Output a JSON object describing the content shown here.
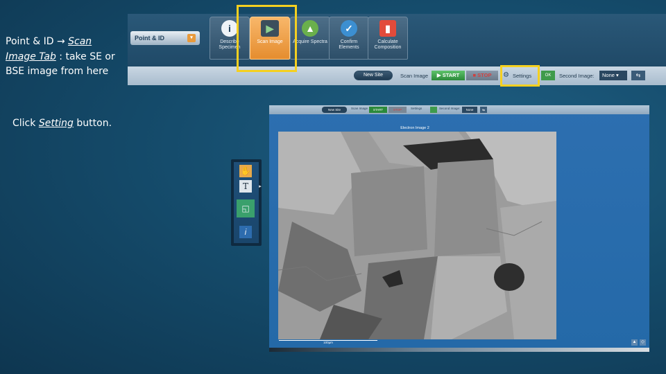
{
  "slide": {
    "line1_prefix": "Point & ID ",
    "arrow": "→",
    "line1_link": "Scan",
    "line2_link": "Image Tab",
    "line2_rest": " : take SE or",
    "line3": "BSE image from here",
    "click_prefix": "Click ",
    "click_link": "Setting",
    "click_suffix": " button."
  },
  "ribbon": {
    "point_id_label": "Point & ID",
    "tabs": [
      {
        "label": "Describe Specimen",
        "icon": "info-icon"
      },
      {
        "label": "Scan Image",
        "icon": "scan-image-icon",
        "active": true
      },
      {
        "label": "Acquire Spectra",
        "icon": "acquire-spectra-icon"
      },
      {
        "label": "Confirm Elements",
        "icon": "confirm-elements-icon"
      },
      {
        "label": "Calculate Composition",
        "icon": "calculate-composition-icon"
      }
    ]
  },
  "toolbar": {
    "new_site": "New Site",
    "scan_image": "Scan Image",
    "start": "START",
    "stop": "STOP",
    "settings": "Settings",
    "ok": "OK",
    "second_image": "Second Image:",
    "second_image_value": "None"
  },
  "app": {
    "toolbar": {
      "new_site": "New Site",
      "scan_image": "Scan Image",
      "start": "START",
      "stop": "STOP",
      "settings": "Settings",
      "second_image": "Second Image:",
      "second_image_value": "None"
    },
    "image_title": "Electron Image 2",
    "scale_label": "100µm"
  },
  "colors": {
    "highlight": "#f5d020",
    "active_tab": "#e58d2f",
    "start": "#2b8a3a"
  }
}
